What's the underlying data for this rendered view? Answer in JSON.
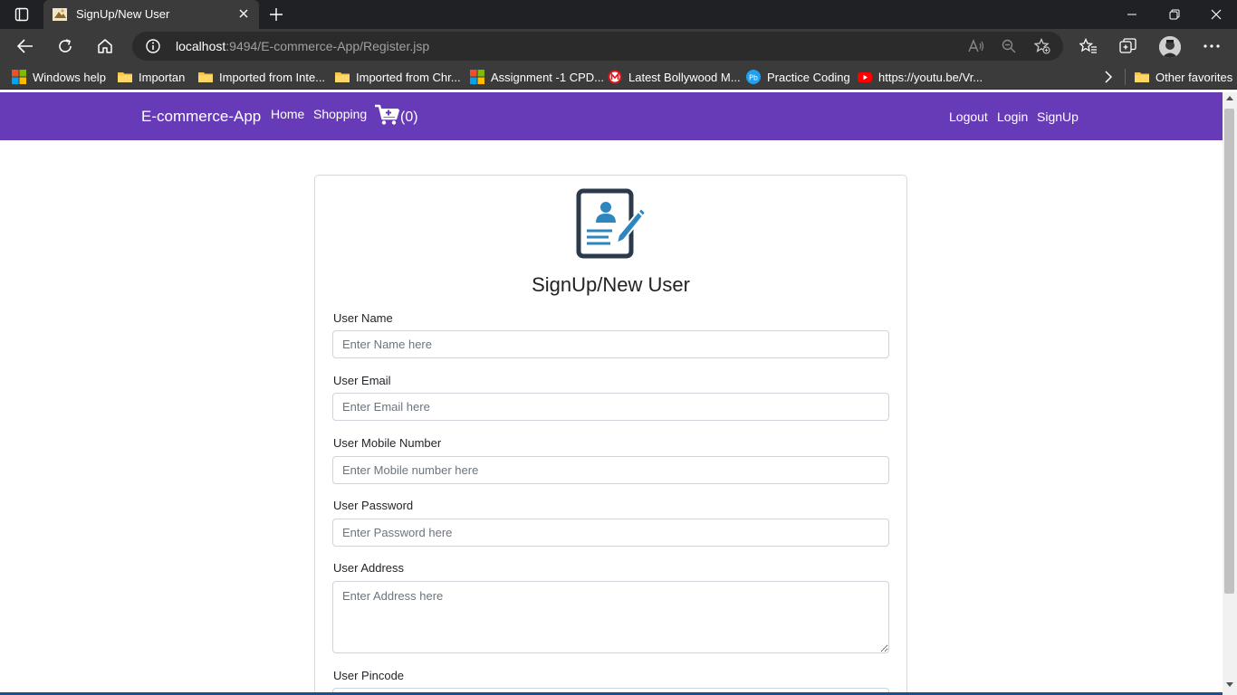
{
  "browser": {
    "tab_title": "SignUp/New User",
    "url_host": "localhost",
    "url_rest": ":9494/E-commerce-App/Register.jsp",
    "bookmarks": [
      {
        "label": "Windows help",
        "icon": "windows-logo-icon"
      },
      {
        "label": "Importan",
        "icon": "folder-icon"
      },
      {
        "label": "Imported from Inte...",
        "icon": "folder-icon"
      },
      {
        "label": "Imported from Chr...",
        "icon": "folder-icon"
      },
      {
        "label": "Assignment -1 CPD...",
        "icon": "windows-logo-icon"
      },
      {
        "label": "Latest Bollywood M...",
        "icon": "m-logo-icon"
      },
      {
        "label": "Practice Coding",
        "icon": "pb-logo-icon"
      },
      {
        "label": "https://youtu.be/Vr...",
        "icon": "youtube-icon"
      }
    ],
    "other_favorites": "Other favorites"
  },
  "navbar": {
    "brand": "E-commerce-App",
    "links": [
      "Home",
      "Shopping"
    ],
    "cart_count": "(0)",
    "right_links": [
      "Logout",
      "Login",
      "SignUp"
    ],
    "color": "#673ab7"
  },
  "form": {
    "title": "SignUp/New User",
    "fields": [
      {
        "label": "User Name",
        "placeholder": "Enter Name here"
      },
      {
        "label": "User Email",
        "placeholder": "Enter Email here"
      },
      {
        "label": "User Mobile Number",
        "placeholder": "Enter Mobile number here"
      },
      {
        "label": "User Password",
        "placeholder": "Enter Password here"
      },
      {
        "label": "User Address",
        "placeholder": "Enter Address here"
      },
      {
        "label": "User Pincode",
        "placeholder": ""
      }
    ]
  }
}
